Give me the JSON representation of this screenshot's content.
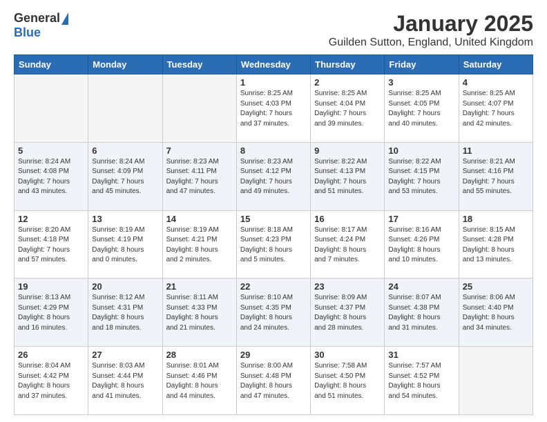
{
  "logo": {
    "general": "General",
    "blue": "Blue"
  },
  "title": "January 2025",
  "subtitle": "Guilden Sutton, England, United Kingdom",
  "weekdays": [
    "Sunday",
    "Monday",
    "Tuesday",
    "Wednesday",
    "Thursday",
    "Friday",
    "Saturday"
  ],
  "weeks": [
    [
      {
        "day": "",
        "info": ""
      },
      {
        "day": "",
        "info": ""
      },
      {
        "day": "",
        "info": ""
      },
      {
        "day": "1",
        "info": "Sunrise: 8:25 AM\nSunset: 4:03 PM\nDaylight: 7 hours\nand 37 minutes."
      },
      {
        "day": "2",
        "info": "Sunrise: 8:25 AM\nSunset: 4:04 PM\nDaylight: 7 hours\nand 39 minutes."
      },
      {
        "day": "3",
        "info": "Sunrise: 8:25 AM\nSunset: 4:05 PM\nDaylight: 7 hours\nand 40 minutes."
      },
      {
        "day": "4",
        "info": "Sunrise: 8:25 AM\nSunset: 4:07 PM\nDaylight: 7 hours\nand 42 minutes."
      }
    ],
    [
      {
        "day": "5",
        "info": "Sunrise: 8:24 AM\nSunset: 4:08 PM\nDaylight: 7 hours\nand 43 minutes."
      },
      {
        "day": "6",
        "info": "Sunrise: 8:24 AM\nSunset: 4:09 PM\nDaylight: 7 hours\nand 45 minutes."
      },
      {
        "day": "7",
        "info": "Sunrise: 8:23 AM\nSunset: 4:11 PM\nDaylight: 7 hours\nand 47 minutes."
      },
      {
        "day": "8",
        "info": "Sunrise: 8:23 AM\nSunset: 4:12 PM\nDaylight: 7 hours\nand 49 minutes."
      },
      {
        "day": "9",
        "info": "Sunrise: 8:22 AM\nSunset: 4:13 PM\nDaylight: 7 hours\nand 51 minutes."
      },
      {
        "day": "10",
        "info": "Sunrise: 8:22 AM\nSunset: 4:15 PM\nDaylight: 7 hours\nand 53 minutes."
      },
      {
        "day": "11",
        "info": "Sunrise: 8:21 AM\nSunset: 4:16 PM\nDaylight: 7 hours\nand 55 minutes."
      }
    ],
    [
      {
        "day": "12",
        "info": "Sunrise: 8:20 AM\nSunset: 4:18 PM\nDaylight: 7 hours\nand 57 minutes."
      },
      {
        "day": "13",
        "info": "Sunrise: 8:19 AM\nSunset: 4:19 PM\nDaylight: 8 hours\nand 0 minutes."
      },
      {
        "day": "14",
        "info": "Sunrise: 8:19 AM\nSunset: 4:21 PM\nDaylight: 8 hours\nand 2 minutes."
      },
      {
        "day": "15",
        "info": "Sunrise: 8:18 AM\nSunset: 4:23 PM\nDaylight: 8 hours\nand 5 minutes."
      },
      {
        "day": "16",
        "info": "Sunrise: 8:17 AM\nSunset: 4:24 PM\nDaylight: 8 hours\nand 7 minutes."
      },
      {
        "day": "17",
        "info": "Sunrise: 8:16 AM\nSunset: 4:26 PM\nDaylight: 8 hours\nand 10 minutes."
      },
      {
        "day": "18",
        "info": "Sunrise: 8:15 AM\nSunset: 4:28 PM\nDaylight: 8 hours\nand 13 minutes."
      }
    ],
    [
      {
        "day": "19",
        "info": "Sunrise: 8:13 AM\nSunset: 4:29 PM\nDaylight: 8 hours\nand 16 minutes."
      },
      {
        "day": "20",
        "info": "Sunrise: 8:12 AM\nSunset: 4:31 PM\nDaylight: 8 hours\nand 18 minutes."
      },
      {
        "day": "21",
        "info": "Sunrise: 8:11 AM\nSunset: 4:33 PM\nDaylight: 8 hours\nand 21 minutes."
      },
      {
        "day": "22",
        "info": "Sunrise: 8:10 AM\nSunset: 4:35 PM\nDaylight: 8 hours\nand 24 minutes."
      },
      {
        "day": "23",
        "info": "Sunrise: 8:09 AM\nSunset: 4:37 PM\nDaylight: 8 hours\nand 28 minutes."
      },
      {
        "day": "24",
        "info": "Sunrise: 8:07 AM\nSunset: 4:38 PM\nDaylight: 8 hours\nand 31 minutes."
      },
      {
        "day": "25",
        "info": "Sunrise: 8:06 AM\nSunset: 4:40 PM\nDaylight: 8 hours\nand 34 minutes."
      }
    ],
    [
      {
        "day": "26",
        "info": "Sunrise: 8:04 AM\nSunset: 4:42 PM\nDaylight: 8 hours\nand 37 minutes."
      },
      {
        "day": "27",
        "info": "Sunrise: 8:03 AM\nSunset: 4:44 PM\nDaylight: 8 hours\nand 41 minutes."
      },
      {
        "day": "28",
        "info": "Sunrise: 8:01 AM\nSunset: 4:46 PM\nDaylight: 8 hours\nand 44 minutes."
      },
      {
        "day": "29",
        "info": "Sunrise: 8:00 AM\nSunset: 4:48 PM\nDaylight: 8 hours\nand 47 minutes."
      },
      {
        "day": "30",
        "info": "Sunrise: 7:58 AM\nSunset: 4:50 PM\nDaylight: 8 hours\nand 51 minutes."
      },
      {
        "day": "31",
        "info": "Sunrise: 7:57 AM\nSunset: 4:52 PM\nDaylight: 8 hours\nand 54 minutes."
      },
      {
        "day": "",
        "info": ""
      }
    ]
  ]
}
